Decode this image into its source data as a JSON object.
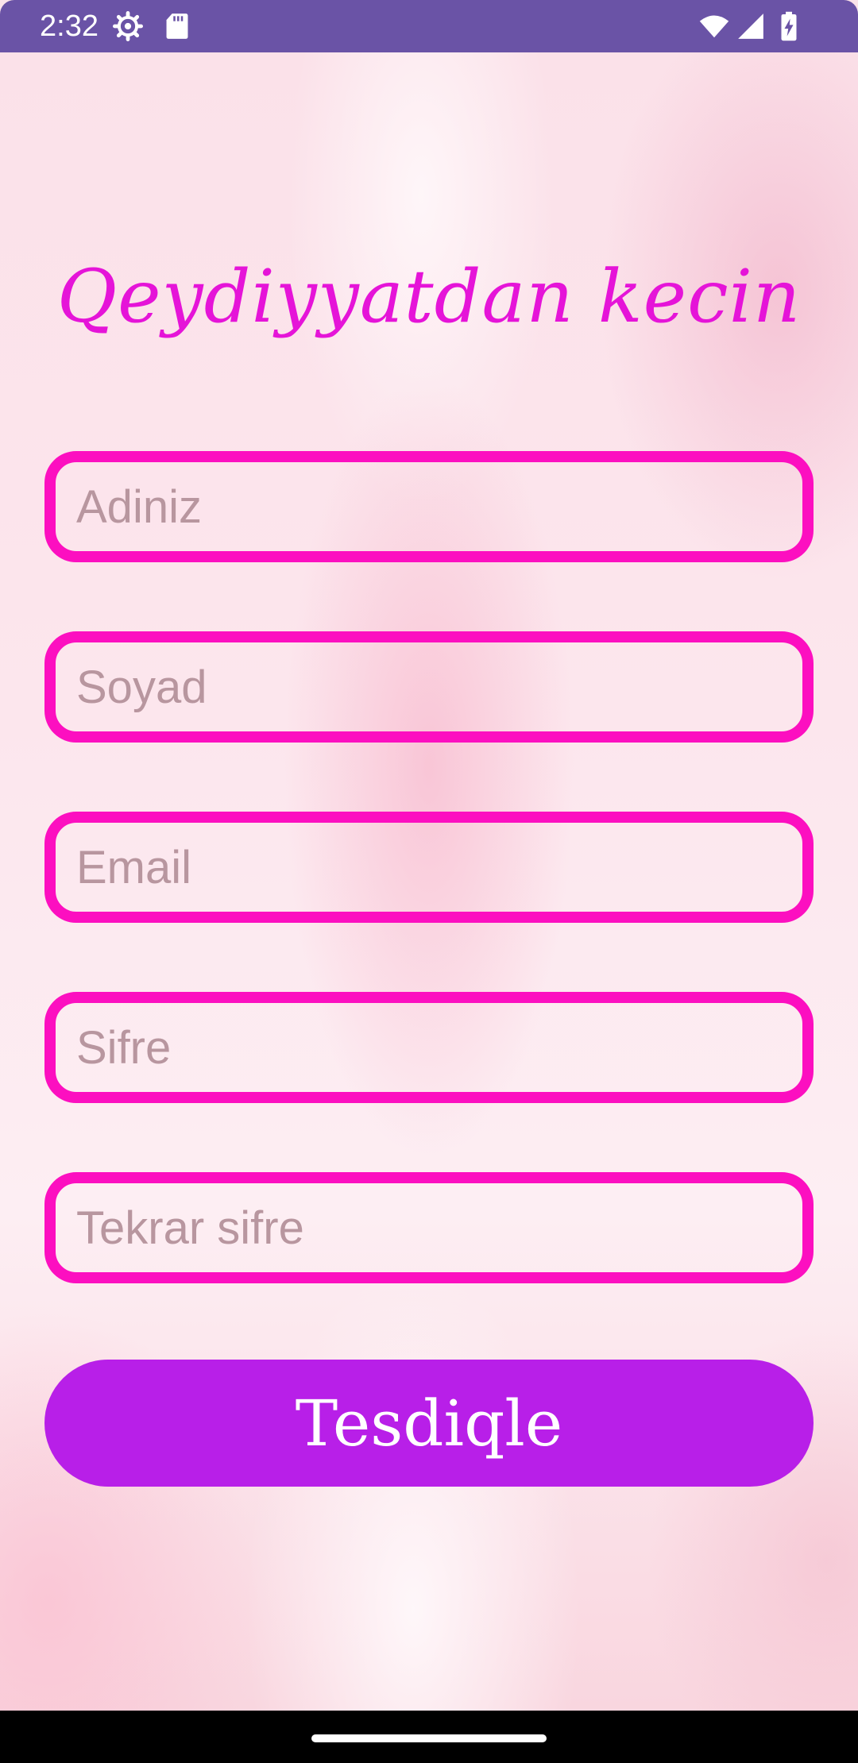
{
  "status_bar": {
    "time": "2:32",
    "icons": [
      "settings-gear-icon",
      "sd-card-icon",
      "wifi-icon",
      "signal-icon",
      "battery-charging-icon"
    ],
    "color": "#6a53a6"
  },
  "title": "Qeydiyyatdan kecin",
  "form": {
    "fields": [
      {
        "placeholder": "Adiniz"
      },
      {
        "placeholder": "Soyad"
      },
      {
        "placeholder": "Email"
      },
      {
        "placeholder": "Sifre"
      },
      {
        "placeholder": "Tekrar sifre"
      }
    ],
    "submit_label": "Tesdiqle"
  },
  "colors": {
    "accent_border": "#fc0fc0",
    "title": "#e514d8",
    "button": "#b81fe8",
    "placeholder": "#b8969f"
  }
}
